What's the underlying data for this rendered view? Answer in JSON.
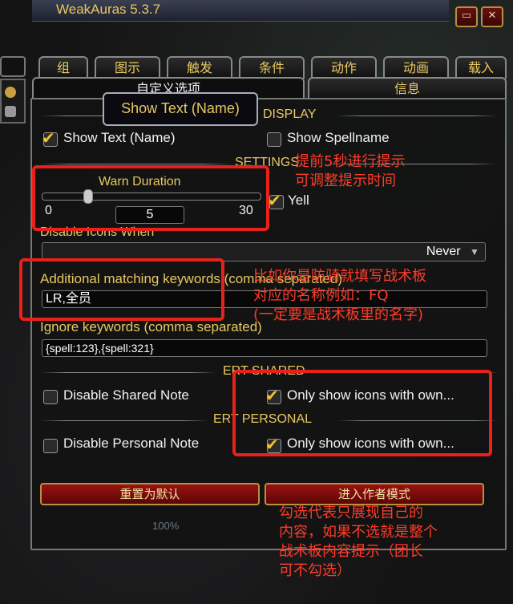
{
  "window": {
    "title": "WeakAuras 5.3.7",
    "close_icon": "x-icon",
    "resize_icon": "resize-icon"
  },
  "tabs": [
    "组",
    "图示",
    "触发",
    "条件",
    "动作",
    "动画",
    "载入"
  ],
  "subtabs": [
    "自定义选项",
    "信息"
  ],
  "tooltip": "Show Text (Name)",
  "sections": {
    "display": "DISPLAY",
    "settings": "SETTINGS",
    "ert_shared": "ERT SHARED",
    "ert_personal": "ERT PERSONAL"
  },
  "checkboxes": {
    "show_text": {
      "label": "Show Text (Name)",
      "checked": true
    },
    "show_spellname": {
      "label": "Show Spellname",
      "checked": false
    },
    "yell": {
      "label": "Yell",
      "checked": true
    },
    "disable_shared": {
      "label": "Disable Shared Note",
      "checked": false
    },
    "only_show_shared": {
      "label": "Only show icons with own...",
      "checked": true
    },
    "disable_personal": {
      "label": "Disable Personal Note",
      "checked": false
    },
    "only_show_personal": {
      "label": "Only show icons with own...",
      "checked": true
    }
  },
  "warn_duration": {
    "label": "Warn Duration",
    "min": "0",
    "max": "30",
    "value": "5",
    "fraction": 0.1667
  },
  "disable_icons": {
    "label": "Disable Icons When",
    "value": "Never"
  },
  "additional_keywords": {
    "label": "Additional matching keywords (comma separated)",
    "value": "LR,全员"
  },
  "ignore_keywords": {
    "label": "Ignore keywords (comma separated)",
    "value": "{spell:123},{spell:321}"
  },
  "buttons": {
    "reset": "重置为默认",
    "author_mode": "进入作者模式"
  },
  "annotations": {
    "warn": [
      "提前5秒进行提示",
      "可调整提示时间"
    ],
    "keywords": [
      "比如你是防骑就填写战术板",
      "对应的名称例如：FQ",
      "(一定要是战术板里的名字)"
    ],
    "only_show": [
      "勾选代表只展现自己的",
      "内容，如果不选就是整个",
      "战术板内容提示（团长",
      "可不勾选）"
    ]
  },
  "background_text": {
    "progress": "100%"
  },
  "colors": {
    "accent": "#e8c860",
    "annotation": "#ff3b2a",
    "button": "#9a1212"
  }
}
